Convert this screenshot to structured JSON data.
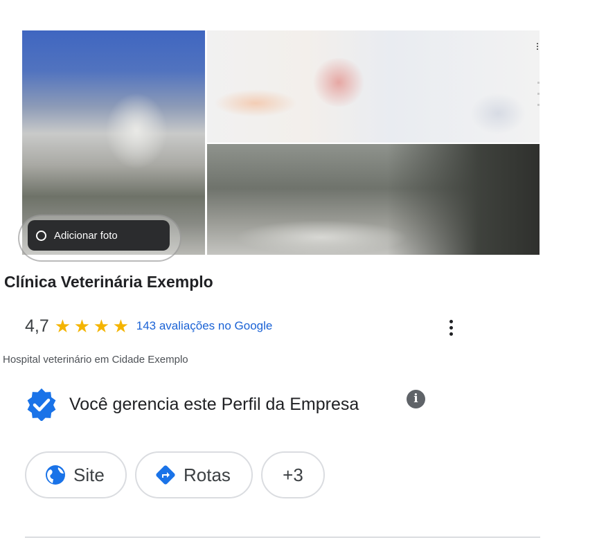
{
  "photos": {
    "add_photo_label": "Adicionar foto"
  },
  "business": {
    "name": "Clínica Veterinária Exemplo",
    "rating": "4,7",
    "stars": 4,
    "reviews_label": "143 avaliações no Google",
    "category": "Hospital veterinário em Cidade Exemplo"
  },
  "verified": {
    "label": "Você gerencia este Perfil da Empresa",
    "icon": "verified-badge-icon",
    "info_icon": "info-icon"
  },
  "actions": {
    "site_label": "Site",
    "rotas_label": "Rotas",
    "more_label": "+3"
  },
  "colors": {
    "link": "#1a62d5",
    "star": "#f4b400",
    "accent": "#1a73e8"
  }
}
